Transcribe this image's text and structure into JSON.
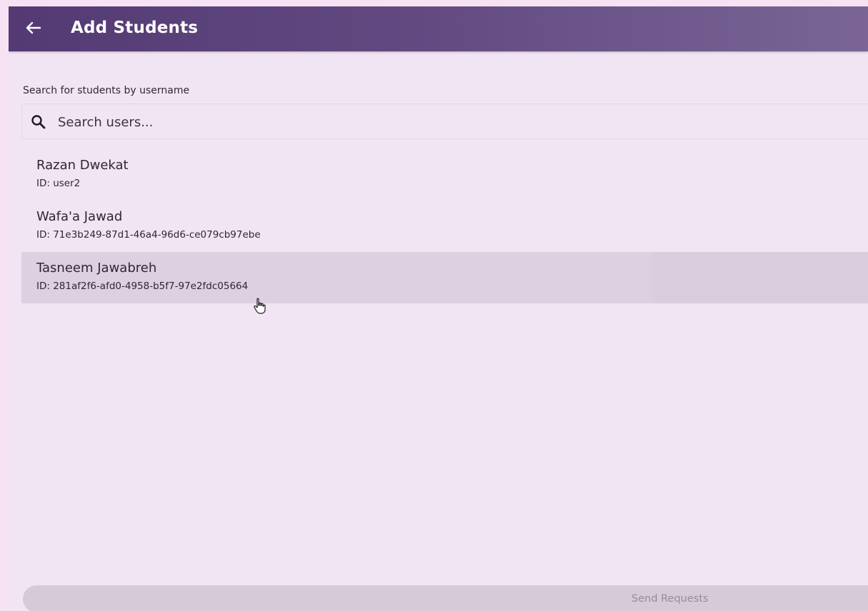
{
  "appbar": {
    "title": "Add Students",
    "back_icon": "arrow-back-icon"
  },
  "search": {
    "label": "Search for students by username",
    "placeholder": "Search users...",
    "value": "",
    "icon": "search-icon"
  },
  "users": [
    {
      "name": "Razan Dwekat",
      "id": "ID: user2",
      "selected": false
    },
    {
      "name": "Wafa'a Jawad",
      "id": "ID: 71e3b249-87d1-46a4-96d6-ce079cb97ebe",
      "selected": false
    },
    {
      "name": "Tasneem Jawabreh",
      "id": "ID: 281af2f6-afd0-4958-b5f7-97e2fdc05664",
      "selected": true
    }
  ],
  "footer": {
    "send_label": "Send Requests",
    "send_enabled": false
  },
  "colors": {
    "appbar_start": "#533a73",
    "appbar_end": "#7a6596",
    "background": "#f1e4f3",
    "selected_row": "#ddd0e0",
    "disabled_button": "#d6cad8"
  }
}
